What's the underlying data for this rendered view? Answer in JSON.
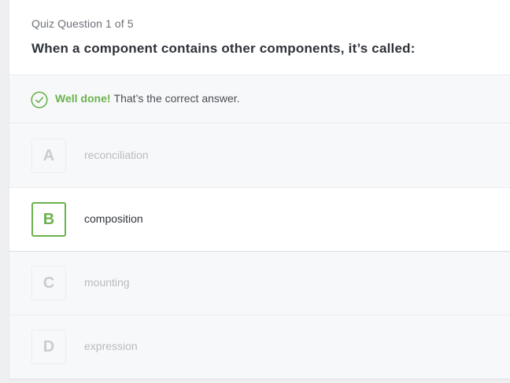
{
  "quiz": {
    "progress_label": "Quiz Question 1 of 5",
    "question": "When a component contains other components, it’s called:"
  },
  "feedback": {
    "icon": "check-circle-icon",
    "headline": "Well done!",
    "message": "That’s the correct answer.",
    "accent_color": "#6bb24e"
  },
  "options": [
    {
      "letter": "A",
      "text": "reconciliation",
      "selected": false
    },
    {
      "letter": "B",
      "text": "composition",
      "selected": true
    },
    {
      "letter": "C",
      "text": "mounting",
      "selected": false
    },
    {
      "letter": "D",
      "text": "expression",
      "selected": false
    }
  ]
}
